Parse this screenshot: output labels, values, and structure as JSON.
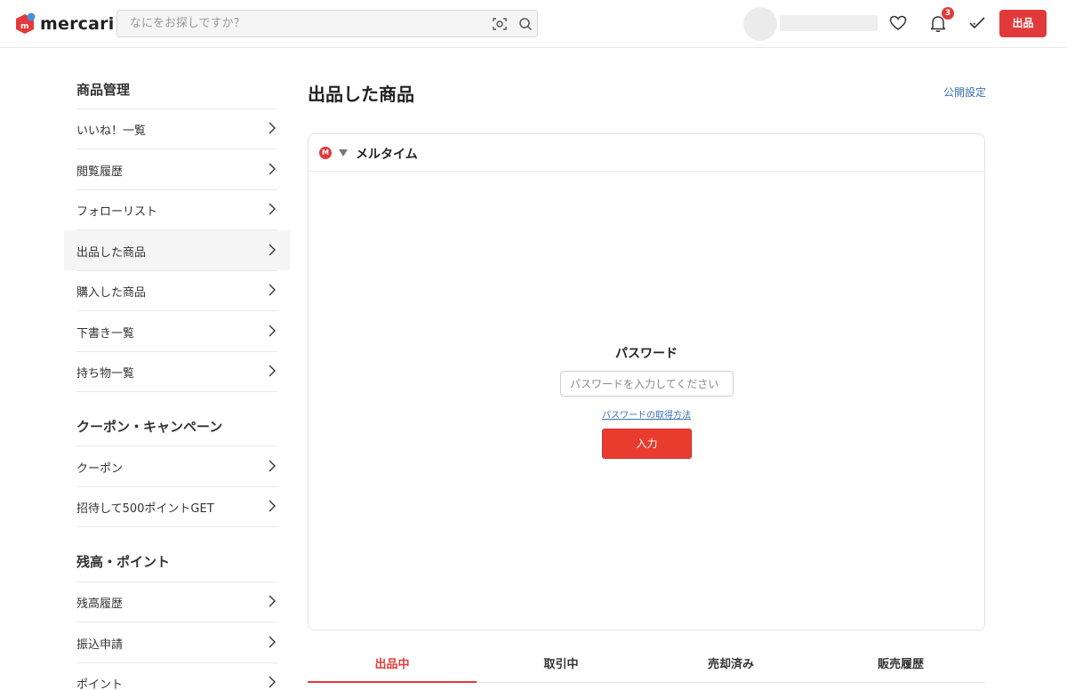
{
  "header": {
    "logo_text": "mercari",
    "search_placeholder": "なにをお探しですか？",
    "notification_count": "3",
    "sell_label": "出品"
  },
  "sidebar": {
    "sections": [
      {
        "heading": "商品管理",
        "items": [
          {
            "label": "いいね！一覧"
          },
          {
            "label": "閲覧履歴"
          },
          {
            "label": "フォローリスト"
          },
          {
            "label": "出品した商品",
            "active": true
          },
          {
            "label": "購入した商品"
          },
          {
            "label": "下書き一覧"
          },
          {
            "label": "持ち物一覧"
          }
        ]
      },
      {
        "heading": "クーポン・キャンペーン",
        "items": [
          {
            "label": "クーポン"
          },
          {
            "label": "招待して500ポイントGET"
          }
        ]
      },
      {
        "heading": "残高・ポイント",
        "items": [
          {
            "label": "残高履歴"
          },
          {
            "label": "振込申請"
          },
          {
            "label": "ポイント"
          }
        ]
      }
    ]
  },
  "main": {
    "title": "出品した商品",
    "public_settings_link": "公開設定",
    "panel": {
      "title": "メルタイム",
      "logo_letter": "M",
      "password_label": "パスワード",
      "password_placeholder": "パスワードを入力してください",
      "help_link": "パスワードの取得方法",
      "submit_label": "入力"
    },
    "tabs": [
      {
        "label": "出品中",
        "active": true
      },
      {
        "label": "取引中"
      },
      {
        "label": "売却済み"
      },
      {
        "label": "販売履歴"
      }
    ]
  },
  "colors": {
    "brand_red": "#e23a3a",
    "link_blue": "#3b6fb0"
  }
}
